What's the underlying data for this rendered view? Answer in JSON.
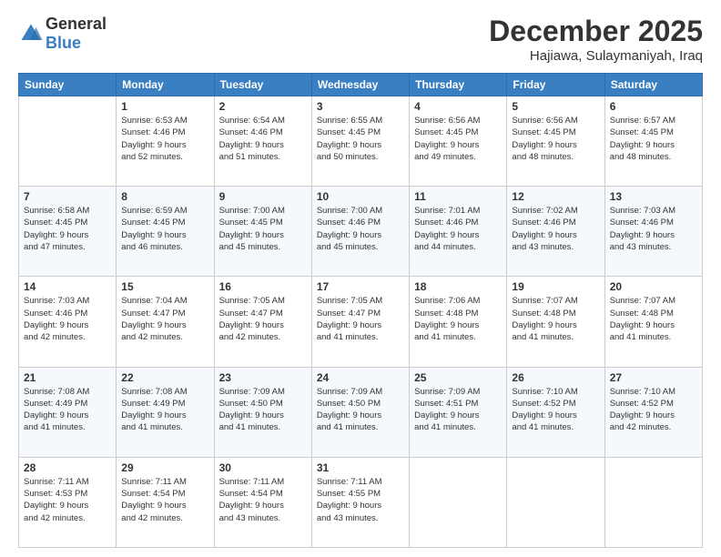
{
  "logo": {
    "general": "General",
    "blue": "Blue"
  },
  "header": {
    "month": "December 2025",
    "location": "Hajiawa, Sulaymaniyah, Iraq"
  },
  "weekdays": [
    "Sunday",
    "Monday",
    "Tuesday",
    "Wednesday",
    "Thursday",
    "Friday",
    "Saturday"
  ],
  "weeks": [
    [
      {
        "day": "",
        "info": ""
      },
      {
        "day": "1",
        "info": "Sunrise: 6:53 AM\nSunset: 4:46 PM\nDaylight: 9 hours\nand 52 minutes."
      },
      {
        "day": "2",
        "info": "Sunrise: 6:54 AM\nSunset: 4:46 PM\nDaylight: 9 hours\nand 51 minutes."
      },
      {
        "day": "3",
        "info": "Sunrise: 6:55 AM\nSunset: 4:45 PM\nDaylight: 9 hours\nand 50 minutes."
      },
      {
        "day": "4",
        "info": "Sunrise: 6:56 AM\nSunset: 4:45 PM\nDaylight: 9 hours\nand 49 minutes."
      },
      {
        "day": "5",
        "info": "Sunrise: 6:56 AM\nSunset: 4:45 PM\nDaylight: 9 hours\nand 48 minutes."
      },
      {
        "day": "6",
        "info": "Sunrise: 6:57 AM\nSunset: 4:45 PM\nDaylight: 9 hours\nand 48 minutes."
      }
    ],
    [
      {
        "day": "7",
        "info": "Sunrise: 6:58 AM\nSunset: 4:45 PM\nDaylight: 9 hours\nand 47 minutes."
      },
      {
        "day": "8",
        "info": "Sunrise: 6:59 AM\nSunset: 4:45 PM\nDaylight: 9 hours\nand 46 minutes."
      },
      {
        "day": "9",
        "info": "Sunrise: 7:00 AM\nSunset: 4:45 PM\nDaylight: 9 hours\nand 45 minutes."
      },
      {
        "day": "10",
        "info": "Sunrise: 7:00 AM\nSunset: 4:46 PM\nDaylight: 9 hours\nand 45 minutes."
      },
      {
        "day": "11",
        "info": "Sunrise: 7:01 AM\nSunset: 4:46 PM\nDaylight: 9 hours\nand 44 minutes."
      },
      {
        "day": "12",
        "info": "Sunrise: 7:02 AM\nSunset: 4:46 PM\nDaylight: 9 hours\nand 43 minutes."
      },
      {
        "day": "13",
        "info": "Sunrise: 7:03 AM\nSunset: 4:46 PM\nDaylight: 9 hours\nand 43 minutes."
      }
    ],
    [
      {
        "day": "14",
        "info": "Sunrise: 7:03 AM\nSunset: 4:46 PM\nDaylight: 9 hours\nand 42 minutes."
      },
      {
        "day": "15",
        "info": "Sunrise: 7:04 AM\nSunset: 4:47 PM\nDaylight: 9 hours\nand 42 minutes."
      },
      {
        "day": "16",
        "info": "Sunrise: 7:05 AM\nSunset: 4:47 PM\nDaylight: 9 hours\nand 42 minutes."
      },
      {
        "day": "17",
        "info": "Sunrise: 7:05 AM\nSunset: 4:47 PM\nDaylight: 9 hours\nand 41 minutes."
      },
      {
        "day": "18",
        "info": "Sunrise: 7:06 AM\nSunset: 4:48 PM\nDaylight: 9 hours\nand 41 minutes."
      },
      {
        "day": "19",
        "info": "Sunrise: 7:07 AM\nSunset: 4:48 PM\nDaylight: 9 hours\nand 41 minutes."
      },
      {
        "day": "20",
        "info": "Sunrise: 7:07 AM\nSunset: 4:48 PM\nDaylight: 9 hours\nand 41 minutes."
      }
    ],
    [
      {
        "day": "21",
        "info": "Sunrise: 7:08 AM\nSunset: 4:49 PM\nDaylight: 9 hours\nand 41 minutes."
      },
      {
        "day": "22",
        "info": "Sunrise: 7:08 AM\nSunset: 4:49 PM\nDaylight: 9 hours\nand 41 minutes."
      },
      {
        "day": "23",
        "info": "Sunrise: 7:09 AM\nSunset: 4:50 PM\nDaylight: 9 hours\nand 41 minutes."
      },
      {
        "day": "24",
        "info": "Sunrise: 7:09 AM\nSunset: 4:50 PM\nDaylight: 9 hours\nand 41 minutes."
      },
      {
        "day": "25",
        "info": "Sunrise: 7:09 AM\nSunset: 4:51 PM\nDaylight: 9 hours\nand 41 minutes."
      },
      {
        "day": "26",
        "info": "Sunrise: 7:10 AM\nSunset: 4:52 PM\nDaylight: 9 hours\nand 41 minutes."
      },
      {
        "day": "27",
        "info": "Sunrise: 7:10 AM\nSunset: 4:52 PM\nDaylight: 9 hours\nand 42 minutes."
      }
    ],
    [
      {
        "day": "28",
        "info": "Sunrise: 7:11 AM\nSunset: 4:53 PM\nDaylight: 9 hours\nand 42 minutes."
      },
      {
        "day": "29",
        "info": "Sunrise: 7:11 AM\nSunset: 4:54 PM\nDaylight: 9 hours\nand 42 minutes."
      },
      {
        "day": "30",
        "info": "Sunrise: 7:11 AM\nSunset: 4:54 PM\nDaylight: 9 hours\nand 43 minutes."
      },
      {
        "day": "31",
        "info": "Sunrise: 7:11 AM\nSunset: 4:55 PM\nDaylight: 9 hours\nand 43 minutes."
      },
      {
        "day": "",
        "info": ""
      },
      {
        "day": "",
        "info": ""
      },
      {
        "day": "",
        "info": ""
      }
    ]
  ]
}
